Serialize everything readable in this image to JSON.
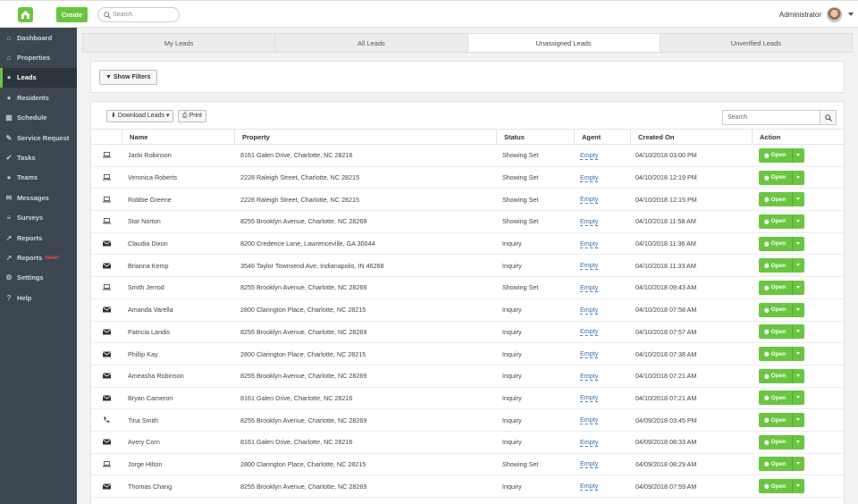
{
  "topbar": {
    "create_label": "Create",
    "search_placeholder": "Search",
    "user_name": "Administrator"
  },
  "sidebar": {
    "items": [
      {
        "label": "Dashboard",
        "icon": "dashboard-icon",
        "glyph": "⌂"
      },
      {
        "label": "Properties",
        "icon": "home-icon",
        "glyph": "⌂"
      },
      {
        "label": "Leads",
        "icon": "users-icon",
        "glyph": "●",
        "active": true
      },
      {
        "label": "Residents",
        "icon": "residents-icon",
        "glyph": "●"
      },
      {
        "label": "Schedule",
        "icon": "calendar-icon",
        "glyph": "▦"
      },
      {
        "label": "Service Request",
        "icon": "wrench-icon",
        "glyph": "✎"
      },
      {
        "label": "Tasks",
        "icon": "tasks-icon",
        "glyph": "✔"
      },
      {
        "label": "Teams",
        "icon": "teams-icon",
        "glyph": "●"
      },
      {
        "label": "Messages",
        "icon": "messages-icon",
        "glyph": "✉"
      },
      {
        "label": "Surveys",
        "icon": "surveys-icon",
        "glyph": "≡"
      },
      {
        "label": "Reports",
        "icon": "chart-icon",
        "glyph": "↗"
      },
      {
        "label": "Reports",
        "icon": "chart-icon",
        "glyph": "↗",
        "badge": "New!"
      },
      {
        "label": "Settings",
        "icon": "gear-icon",
        "glyph": "⚙"
      },
      {
        "label": "Help",
        "icon": "help-icon",
        "glyph": "?"
      }
    ]
  },
  "tabs": [
    "My Leads",
    "All Leads",
    "Unassigned Leads",
    "Unverified Leads"
  ],
  "active_tab_index": 2,
  "filters": {
    "show_filters_label": "Show Filters"
  },
  "toolbar": {
    "download_label": "Download Leads",
    "print_label": "Print",
    "search_placeholder": "Search"
  },
  "table": {
    "columns": [
      "Name",
      "Property",
      "Status",
      "Agent",
      "Created On",
      "Action"
    ],
    "action_label": "Open",
    "rows": [
      {
        "source": "laptop",
        "name": "Jacki Robinson",
        "property": "8161 Galen Drive, Charlotte, NC 28216",
        "status": "Showing Set",
        "agent": "Empty",
        "created": "04/10/2018 03:00 PM"
      },
      {
        "source": "laptop",
        "name": "Veronica Roberts",
        "property": "2228 Raleigh Street, Charlotte, NC 28215",
        "status": "Showing Set",
        "agent": "Empty",
        "created": "04/10/2018 12:19 PM"
      },
      {
        "source": "laptop",
        "name": "Robbie Greene",
        "property": "2228 Raleigh Street, Charlotte, NC 28215",
        "status": "Showing Set",
        "agent": "Empty",
        "created": "04/10/2018 12:15 PM"
      },
      {
        "source": "laptop",
        "name": "Star Norton",
        "property": "8255 Brooklyn Avenue, Charlotte, NC 28269",
        "status": "Showing Set",
        "agent": "Empty",
        "created": "04/10/2018 11:58 AM"
      },
      {
        "source": "envelope",
        "name": "Claudia Dixon",
        "property": "8200 Credence Lane, Lawrenceville, GA 30044",
        "status": "Inquiry",
        "agent": "Empty",
        "created": "04/10/2018 11:36 AM"
      },
      {
        "source": "envelope",
        "name": "Brianna Kemp",
        "property": "3546 Taylor Townsend Ave, Indianapolis, IN 46268",
        "status": "Inquiry",
        "agent": "Empty",
        "created": "04/10/2018 11:33 AM"
      },
      {
        "source": "laptop",
        "name": "Smith Jerrod",
        "property": "8255 Brooklyn Avenue, Charlotte, NC 28269",
        "status": "Showing Set",
        "agent": "Empty",
        "created": "04/10/2018 09:43 AM"
      },
      {
        "source": "envelope",
        "name": "Amanda Varella",
        "property": "2800 Clarington Place, Charlotte, NC 28215",
        "status": "Inquiry",
        "agent": "Empty",
        "created": "04/10/2018 07:58 AM"
      },
      {
        "source": "envelope",
        "name": "Patricia Landis",
        "property": "8255 Brooklyn Avenue, Charlotte, NC 28269",
        "status": "Inquiry",
        "agent": "Empty",
        "created": "04/10/2018 07:57 AM"
      },
      {
        "source": "envelope",
        "name": "Phillip Kay",
        "property": "2800 Clarington Place, Charlotte, NC 28215",
        "status": "Inquiry",
        "agent": "Empty",
        "created": "04/10/2018 07:38 AM"
      },
      {
        "source": "envelope",
        "name": "Ameasha Robinson",
        "property": "8255 Brooklyn Avenue, Charlotte, NC 28269",
        "status": "Inquiry",
        "agent": "Empty",
        "created": "04/10/2018 07:21 AM"
      },
      {
        "source": "envelope",
        "name": "Bryan Cameron",
        "property": "8161 Galen Drive, Charlotte, NC 28216",
        "status": "Inquiry",
        "agent": "Empty",
        "created": "04/10/2018 07:21 AM"
      },
      {
        "source": "phone",
        "name": "Tina Smith",
        "property": "8255 Brooklyn Avenue, Charlotte, NC 28269",
        "status": "Inquiry",
        "agent": "Empty",
        "created": "04/09/2018 03:45 PM"
      },
      {
        "source": "envelope",
        "name": "Avery Corn",
        "property": "8161 Galen Drive, Charlotte, NC 28216",
        "status": "Inquiry",
        "agent": "Empty",
        "created": "04/09/2018 08:33 AM"
      },
      {
        "source": "laptop",
        "name": "Jorge Hilton",
        "property": "2800 Clarington Place, Charlotte, NC 28215",
        "status": "Showing Set",
        "agent": "Empty",
        "created": "04/09/2018 08:29 AM"
      },
      {
        "source": "envelope",
        "name": "Thomas Chang",
        "property": "8255 Brooklyn Avenue, Charlotte, NC 28269",
        "status": "Inquiry",
        "agent": "Empty",
        "created": "04/09/2018 07:59 AM"
      }
    ]
  },
  "colors": {
    "accent": "#6ac641",
    "sidebar_bg": "#3b4650",
    "link": "#3a6fa8"
  }
}
